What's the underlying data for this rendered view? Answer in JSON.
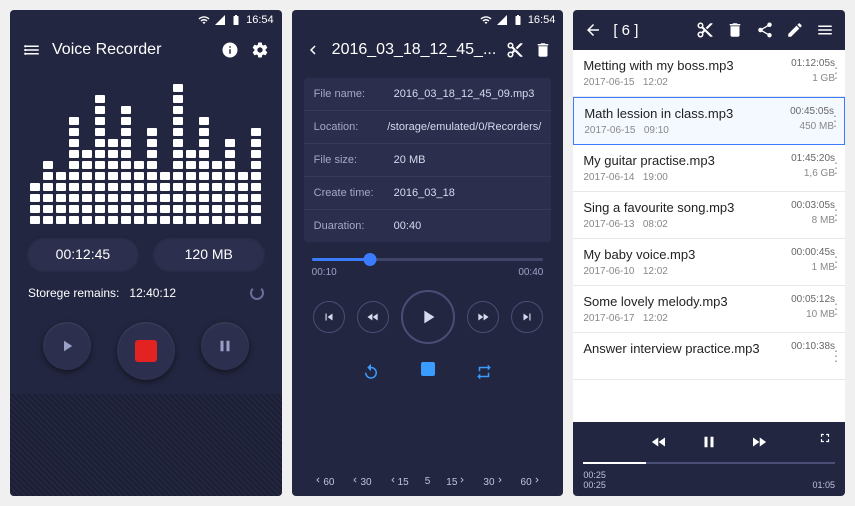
{
  "status": {
    "time": "16:54"
  },
  "screen1": {
    "title": "Voice Recorder",
    "eq_heights": [
      4,
      6,
      5,
      10,
      7,
      12,
      8,
      11,
      6,
      9,
      5,
      13,
      7,
      10,
      6,
      8,
      5,
      9
    ],
    "timer": "00:12:45",
    "size": "120 MB",
    "storage_label": "Storege remains:",
    "storage_value": "12:40:12"
  },
  "screen2": {
    "title": "2016_03_18_12_45_...",
    "info": [
      {
        "k": "File name:",
        "v": "2016_03_18_12_45_09.mp3"
      },
      {
        "k": "Location:",
        "v": "/storage/emulated/0/Recorders/"
      },
      {
        "k": "File size:",
        "v": "20 MB"
      },
      {
        "k": "Create time:",
        "v": "2016_03_18"
      },
      {
        "k": "Duaration:",
        "v": "00:40"
      }
    ],
    "pos": "00:10",
    "dur": "00:40",
    "skips": [
      "60",
      "30",
      "15",
      "5",
      "15",
      "30",
      "60"
    ]
  },
  "screen3": {
    "title": "[ 6 ]",
    "items": [
      {
        "name": "Metting with my boss.mp3",
        "date": "2017-06-15",
        "time": "12:02",
        "dur": "01:12:05s",
        "size": "1 GB",
        "sel": false
      },
      {
        "name": "Math lession in class.mp3",
        "date": "2017-06-15",
        "time": "09:10",
        "dur": "00:45:05s",
        "size": "450 MB",
        "sel": true
      },
      {
        "name": "My guitar practise.mp3",
        "date": "2017-06-14",
        "time": "19:00",
        "dur": "01:45:20s",
        "size": "1,6 GB",
        "sel": false
      },
      {
        "name": "Sing a favourite song.mp3",
        "date": "2017-06-13",
        "time": "08:02",
        "dur": "00:03:05s",
        "size": "8 MB",
        "sel": false
      },
      {
        "name": "My baby voice.mp3",
        "date": "2017-06-10",
        "time": "12:02",
        "dur": "00:00:45s",
        "size": "1 MB",
        "sel": false
      },
      {
        "name": "Some lovely melody.mp3",
        "date": "2017-06-17",
        "time": "12:02",
        "dur": "00:05:12s",
        "size": "10 MB",
        "sel": false
      },
      {
        "name": "Answer interview practice.mp3",
        "date": "",
        "time": "",
        "dur": "00:10:38s",
        "size": "",
        "sel": false
      }
    ],
    "player": {
      "pos": "00:25",
      "rem": "00:25",
      "dur": "01:05"
    }
  }
}
